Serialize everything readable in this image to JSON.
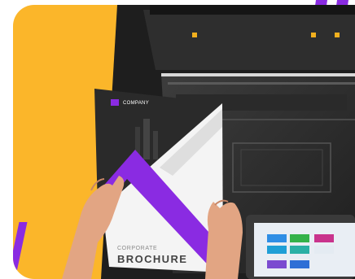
{
  "brochure": {
    "company": "COMPANY",
    "subtitle": "CORPORATE",
    "title": "BROCHURE"
  },
  "colors": {
    "background_yellow": "#fbb62a",
    "accent_purple": "#8a2be2",
    "printer_dark": "#2b2b2b"
  }
}
